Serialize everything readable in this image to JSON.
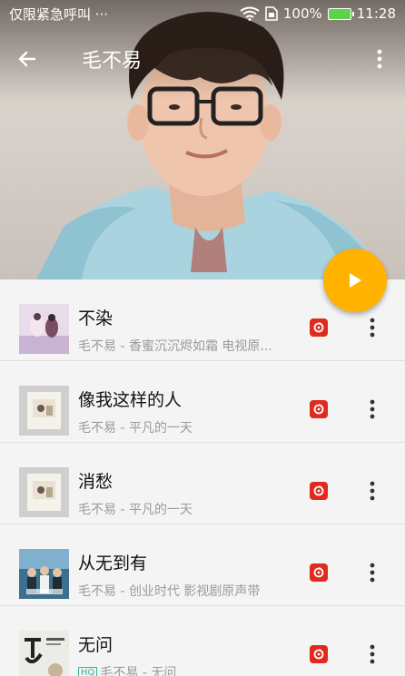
{
  "status_bar": {
    "left_text": "仅限紧急呼叫 ···",
    "battery": "100%",
    "time": "11:28"
  },
  "toolbar": {
    "title": "毛不易"
  },
  "songs": [
    {
      "title": "不染",
      "subtitle": "毛不易 - 香蜜沉沉烬如霜 电视原...",
      "hq": ""
    },
    {
      "title": "像我这样的人",
      "subtitle": "毛不易 - 平凡的一天",
      "hq": ""
    },
    {
      "title": "消愁",
      "subtitle": "毛不易 - 平凡的一天",
      "hq": ""
    },
    {
      "title": "从无到有",
      "subtitle": "毛不易 - 创业时代 影视剧原声带",
      "hq": ""
    },
    {
      "title": "无问",
      "subtitle": "毛不易 - 无问",
      "hq": "HQ"
    }
  ],
  "icons": {
    "back": "arrow-left-icon",
    "more": "more-vert-icon",
    "play": "play-icon",
    "source": "netease-music-icon",
    "wifi": "wifi-icon",
    "sim": "sim-icon",
    "battery": "battery-icon"
  },
  "colors": {
    "fab": "#ffb300",
    "source_icon": "#e02a1e",
    "hq_badge": "#2fb5a4"
  }
}
